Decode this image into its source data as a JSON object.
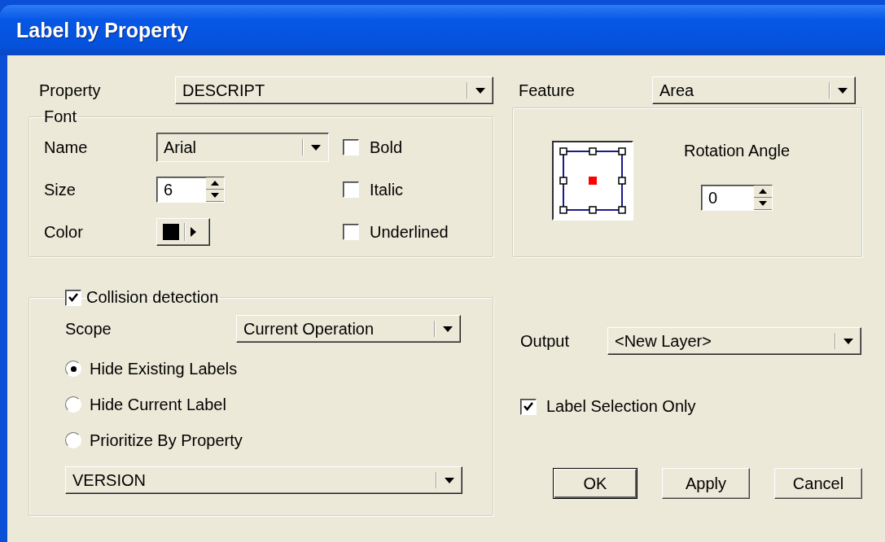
{
  "window": {
    "title": "Label by Property"
  },
  "property": {
    "label": "Property",
    "value": "DESCRIPT"
  },
  "font": {
    "legend": "Font",
    "name": {
      "label": "Name",
      "value": "Arial"
    },
    "size": {
      "label": "Size",
      "value": "6"
    },
    "color": {
      "label": "Color",
      "color": "#000000"
    },
    "styles": [
      {
        "label": "Bold",
        "checked": false
      },
      {
        "label": "Italic",
        "checked": false
      },
      {
        "label": "Underlined",
        "checked": false
      }
    ]
  },
  "feature": {
    "label": "Feature",
    "value": "Area"
  },
  "rotation": {
    "label": "Rotation Angle",
    "value": "0"
  },
  "collision": {
    "label": "Collision detection",
    "checked": true,
    "scope": {
      "label": "Scope",
      "value": "Current Operation"
    },
    "options": [
      {
        "label": "Hide Existing Labels",
        "selected": true
      },
      {
        "label": "Hide Current Label",
        "selected": false
      },
      {
        "label": "Prioritize By Property",
        "selected": false
      }
    ],
    "priority_property": {
      "value": "VERSION"
    }
  },
  "output": {
    "label": "Output",
    "value": "<New Layer>"
  },
  "label_selection_only": {
    "label": "Label Selection Only",
    "checked": true
  },
  "buttons": [
    {
      "label": "OK",
      "default": true
    },
    {
      "label": "Apply",
      "default": false
    },
    {
      "label": "Cancel",
      "default": false
    }
  ]
}
